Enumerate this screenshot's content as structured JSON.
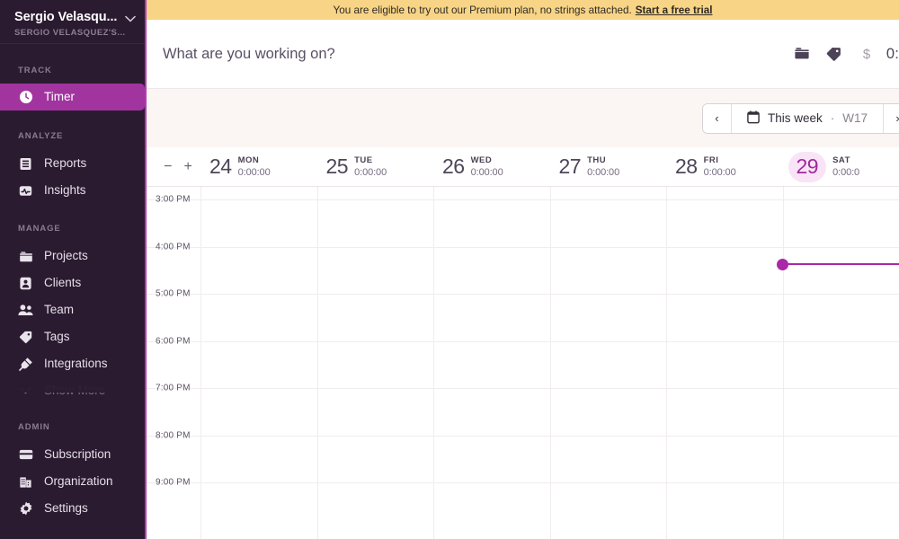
{
  "sidebar": {
    "user": {
      "name": "Sergio Velasqu...",
      "org": "Sergio Velasquez's...",
      "chevron": "chevron-down-icon"
    },
    "sections": [
      {
        "label": "TRACK",
        "items": [
          {
            "label": "Timer",
            "icon": "clock-icon",
            "active": true
          }
        ]
      },
      {
        "label": "ANALYZE",
        "items": [
          {
            "label": "Reports",
            "icon": "report-icon",
            "active": false
          },
          {
            "label": "Insights",
            "icon": "insights-icon",
            "active": false
          }
        ]
      },
      {
        "label": "MANAGE",
        "items": [
          {
            "label": "Projects",
            "icon": "folder-icon",
            "active": false
          },
          {
            "label": "Clients",
            "icon": "client-icon",
            "active": false
          },
          {
            "label": "Team",
            "icon": "team-icon",
            "active": false
          },
          {
            "label": "Tags",
            "icon": "tag-icon",
            "active": false
          },
          {
            "label": "Integrations",
            "icon": "plug-icon",
            "active": false
          }
        ]
      },
      {
        "label": "ADMIN",
        "items": [
          {
            "label": "Subscription",
            "icon": "card-icon",
            "active": false
          },
          {
            "label": "Organization",
            "icon": "building-icon",
            "active": false
          },
          {
            "label": "Settings",
            "icon": "gear-icon",
            "active": false
          }
        ]
      }
    ],
    "show_more": {
      "label": "Show More",
      "icon": "chevron-down-icon"
    },
    "colors": {
      "bg": "#2b1b30",
      "active": "#a234a0",
      "edge": "#b53bb0"
    }
  },
  "banner": {
    "text": "You are eligible to try out our Premium plan, no strings attached.",
    "cta": "Start a free trial",
    "bg": "#f7d486"
  },
  "timer_bar": {
    "placeholder": "What are you working on?",
    "value": "",
    "icons": [
      "folder-icon",
      "tag-icon",
      "dollar-icon"
    ],
    "readout": "0:"
  },
  "date_nav": {
    "prev": "‹",
    "next": "›",
    "calendar_icon": "calendar-icon",
    "label": "This week",
    "separator": "·",
    "week": "W17"
  },
  "zoom_controls": {
    "minus": "−",
    "plus": "+"
  },
  "days": [
    {
      "num": "24",
      "dow": "MON",
      "duration": "0:00:00",
      "today": false
    },
    {
      "num": "25",
      "dow": "TUE",
      "duration": "0:00:00",
      "today": false
    },
    {
      "num": "26",
      "dow": "WED",
      "duration": "0:00:00",
      "today": false
    },
    {
      "num": "27",
      "dow": "THU",
      "duration": "0:00:00",
      "today": false
    },
    {
      "num": "28",
      "dow": "FRI",
      "duration": "0:00:00",
      "today": false
    },
    {
      "num": "29",
      "dow": "SAT",
      "duration": "0:00:0",
      "today": true
    }
  ],
  "grid": {
    "hours": [
      "3:00 PM",
      "4:00 PM",
      "5:00 PM",
      "6:00 PM",
      "7:00 PM",
      "8:00 PM",
      "9:00 PM"
    ],
    "now_color": "#a82aa6"
  }
}
